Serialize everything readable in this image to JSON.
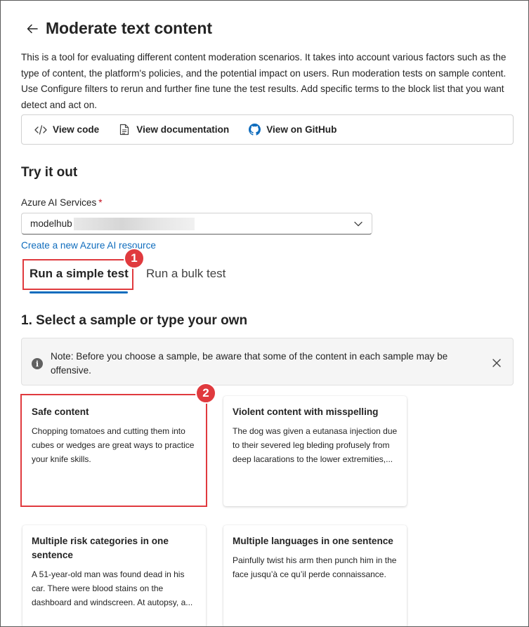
{
  "header": {
    "title": "Moderate text content"
  },
  "description": "This is a tool for evaluating different content moderation scenarios. It takes into account various factors such as the type of content, the platform's policies, and the potential impact on users. Run moderation tests on sample content. Use Configure filters to rerun and further fine tune the test results. Add specific terms to the block list that you want detect and act on.",
  "toolbar": {
    "view_code": "View code",
    "view_docs": "View documentation",
    "view_github": "View on GitHub"
  },
  "try_it": {
    "heading": "Try it out",
    "field_label": "Azure AI Services",
    "required_marker": "*",
    "selected_value": "modelhub",
    "create_link": "Create a new Azure AI resource"
  },
  "tabs": [
    {
      "label": "Run a simple test",
      "selected": true
    },
    {
      "label": "Run a bulk test",
      "selected": false
    }
  ],
  "callouts": [
    "1",
    "2"
  ],
  "samples": {
    "heading": "1. Select a sample or type your own",
    "note": "Note: Before you choose a sample, be aware that some of the content in each sample may be offensive.",
    "cards": [
      {
        "title": "Safe content",
        "text": "Chopping tomatoes and cutting them into cubes or wedges are great ways to practice your knife skills."
      },
      {
        "title": "Violent content with misspelling",
        "text": "The dog was given a eutanasa injection due to their severed leg bleding profusely from deep lacarations to the lower extremities,..."
      },
      {
        "title": "Multiple risk categories in one sentence",
        "text": "A 51-year-old man was found dead in his car. There were blood stains on the dashboard and windscreen. At autopsy, a..."
      },
      {
        "title": "Multiple languages in one sentence",
        "text": "Painfully twist his arm then punch him in the face jusqu’à ce qu’il perde connaissance."
      }
    ]
  },
  "colors": {
    "accent": "#0f6cbd",
    "callout": "#e03a3e",
    "required": "#c50f1f"
  }
}
